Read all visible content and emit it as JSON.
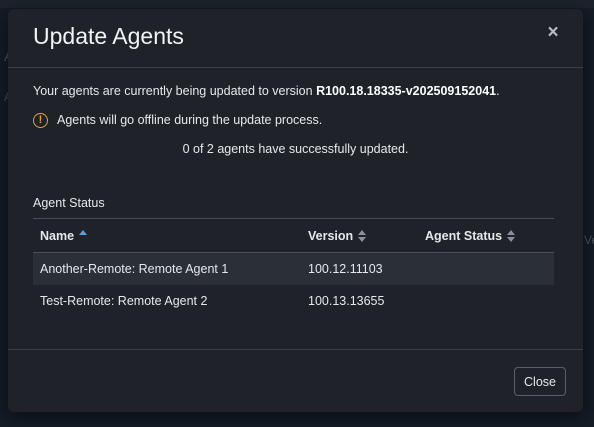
{
  "background": {
    "fragment_a1": "A",
    "fragment_a2": "A",
    "fragment_v": "Ve"
  },
  "modal": {
    "title": "Update Agents",
    "close_icon": "×",
    "message_prefix": "Your agents are currently being updated to version ",
    "version": "R100.18.18335-v202509152041",
    "message_suffix": ".",
    "warning_icon": "!",
    "warning_text": "Agents will go offline during the update process.",
    "progress_text": "0 of 2 agents have successfully updated.",
    "section_label": "Agent Status",
    "table": {
      "columns": [
        "Name",
        "Version",
        "Agent Status"
      ],
      "sort": {
        "column": "Name",
        "direction": "asc"
      },
      "rows": [
        {
          "name": "Another-Remote: Remote Agent 1",
          "version": "100.12.11103",
          "status": ""
        },
        {
          "name": "Test-Remote: Remote Agent 2",
          "version": "100.13.13655",
          "status": ""
        }
      ]
    },
    "close_button_label": "Close"
  },
  "colors": {
    "modal_bg": "#1f2329",
    "accent_sort": "#4ea3e6",
    "warning": "#e0a23a",
    "row_stripe": "#2b3038"
  }
}
